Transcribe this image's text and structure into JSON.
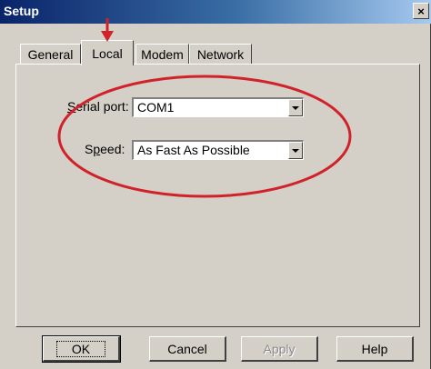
{
  "window": {
    "title": "Setup",
    "close_label": "×"
  },
  "tabs": [
    {
      "label": "General"
    },
    {
      "label": "Local"
    },
    {
      "label": "Modem"
    },
    {
      "label": "Network"
    }
  ],
  "local": {
    "serial_port": {
      "label_access": "S",
      "label_rest": "erial port:",
      "value": "COM1"
    },
    "speed": {
      "label_pre": "S",
      "label_access": "p",
      "label_rest": "eed:",
      "value": "As Fast As Possible"
    }
  },
  "buttons": {
    "ok": "OK",
    "cancel": "Cancel",
    "apply": "Apply",
    "help": "Help"
  },
  "annotation_color": "#d0222a"
}
